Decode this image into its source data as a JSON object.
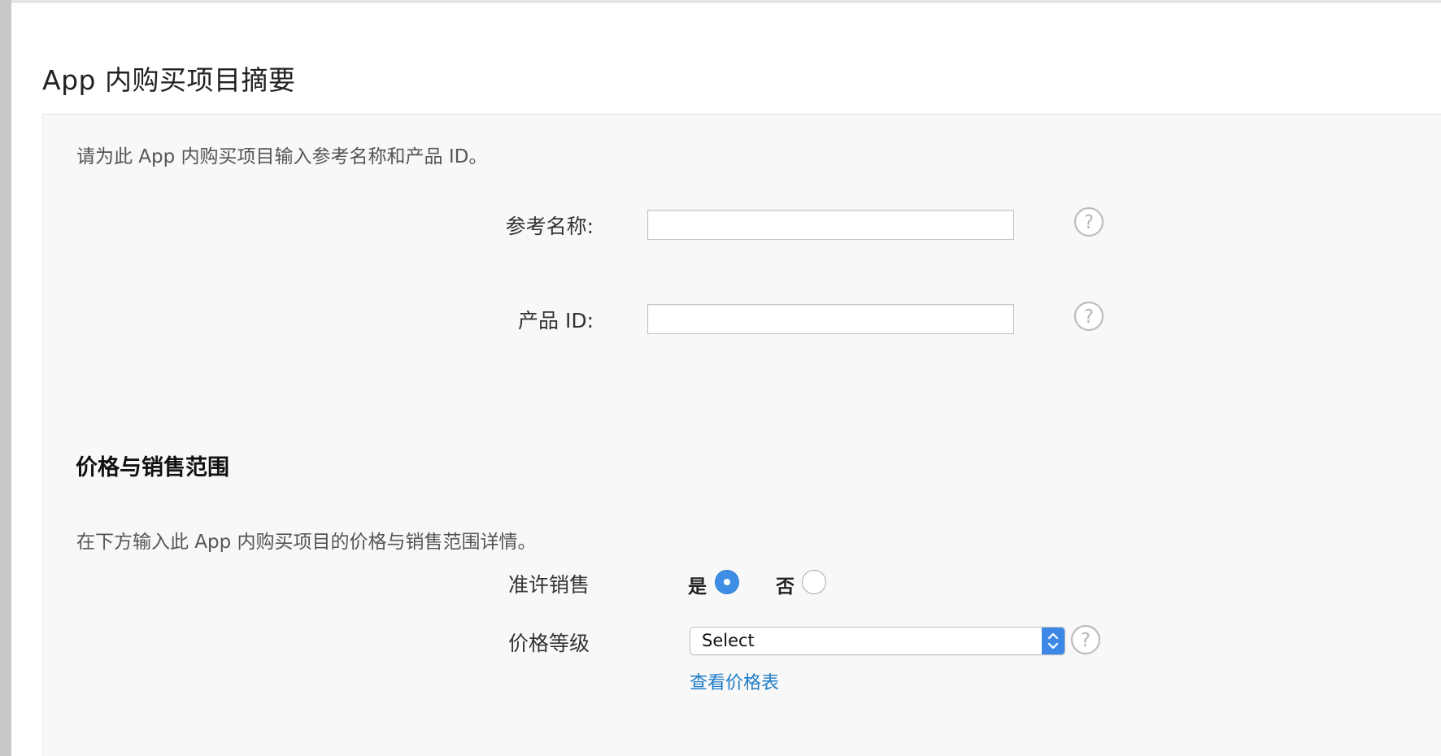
{
  "page": {
    "title": "App 内购买项目摘要"
  },
  "summary": {
    "intro": "请为此 App 内购买项目输入参考名称和产品 ID。",
    "reference_name_label": "参考名称:",
    "reference_name_value": "",
    "product_id_label": "产品 ID:",
    "product_id_value": ""
  },
  "pricing": {
    "heading": "价格与销售范围",
    "description": "在下方输入此 App 内购买项目的价格与销售范围详情。",
    "cleared_label": "准许销售",
    "yes_label": "是",
    "no_label": "否",
    "cleared_selected": "是",
    "tier_label": "价格等级",
    "tier_value": "Select",
    "price_matrix_link": "查看价格表"
  },
  "icons": {
    "help": "question-circle-icon",
    "select_arrows": "chevron-up-down-icon"
  },
  "colors": {
    "accent": "#3f8ee6",
    "link": "#1e7dc9",
    "panel_bg": "#f8f8f8"
  }
}
